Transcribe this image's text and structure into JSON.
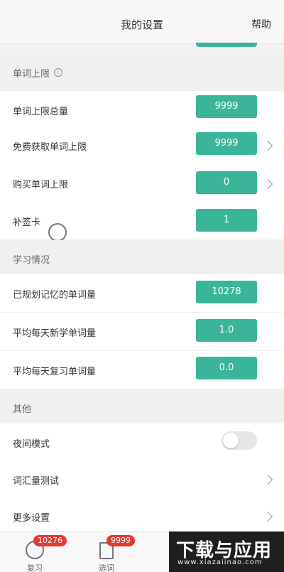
{
  "header": {
    "title": "我的设置",
    "help": "帮助"
  },
  "sections": {
    "word_limit": {
      "title": "单词上限",
      "rows": [
        {
          "label": "单词上限总量",
          "value": "9999"
        },
        {
          "label": "免费获取单词上限",
          "value": "9999"
        },
        {
          "label": "购买单词上限",
          "value": "0"
        },
        {
          "label": "补签卡",
          "value": "1"
        }
      ]
    },
    "study": {
      "title": "学习情况",
      "rows": [
        {
          "label": "已规划记忆的单词量",
          "value": "10278"
        },
        {
          "label": "平均每天新学单词量",
          "value": "1.0"
        },
        {
          "label": "平均每天复习单词量",
          "value": "0.0"
        }
      ]
    },
    "other": {
      "title": "其他",
      "rows": [
        {
          "label": "夜间模式"
        },
        {
          "label": "词汇量测试"
        },
        {
          "label": "更多设置"
        }
      ]
    }
  },
  "night_mode": {
    "on": false
  },
  "tabbar": {
    "review": {
      "label": "复习",
      "badge": "10276"
    },
    "select": {
      "label": "选词",
      "badge": "9999"
    }
  },
  "watermark": {
    "main": "下载与应用",
    "sub": "www.xiazaiinao.com"
  },
  "colors": {
    "accent": "#3bb59a",
    "badge": "#e53935"
  }
}
